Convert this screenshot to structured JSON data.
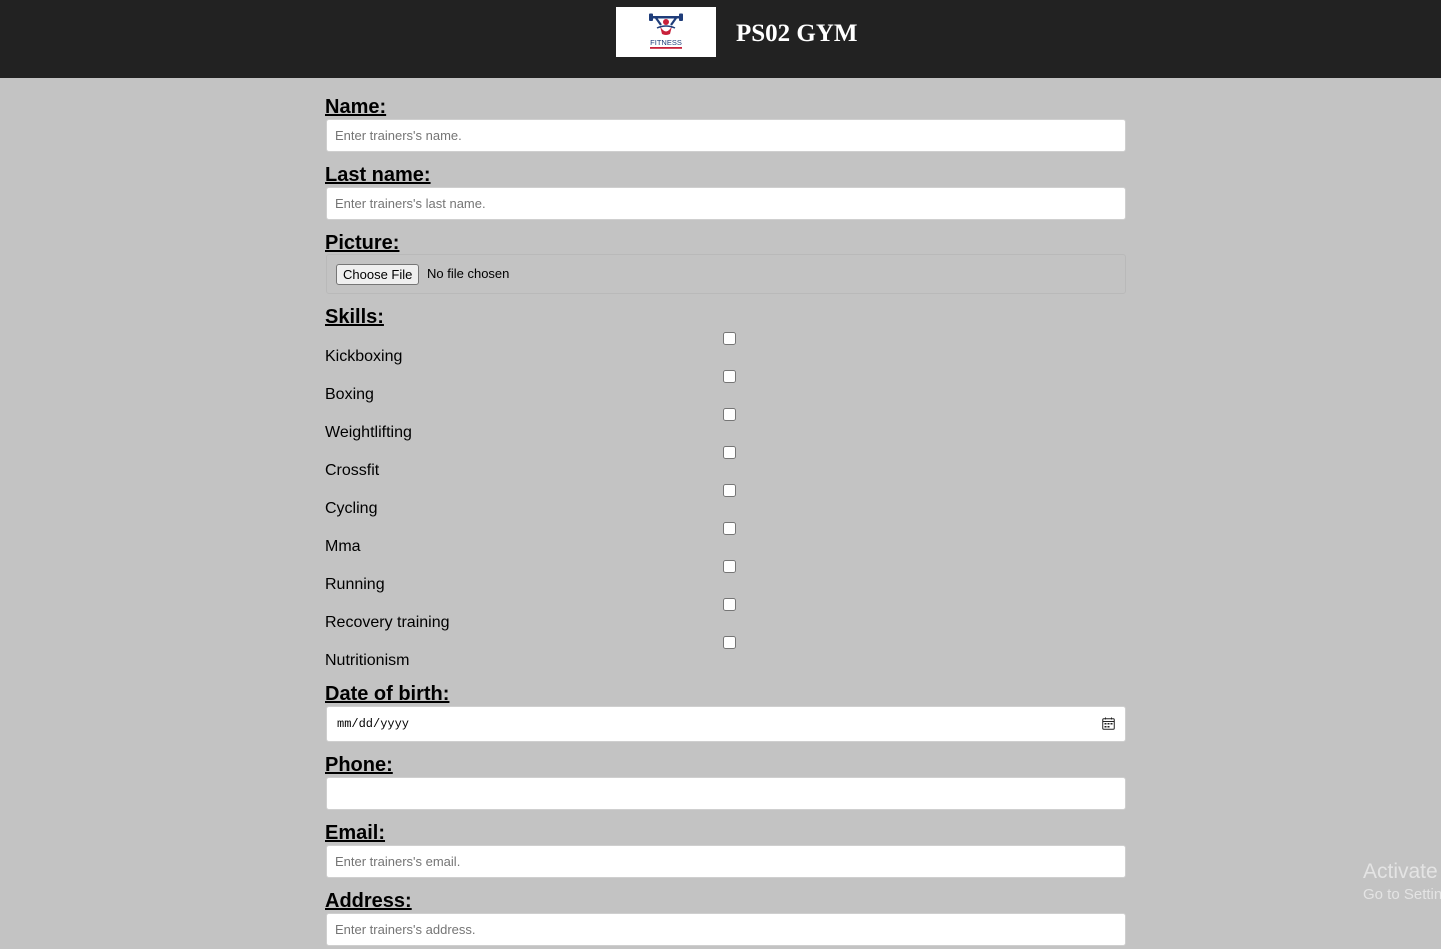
{
  "header": {
    "logo_text": "FITNESS",
    "brand": "PS02 GYM"
  },
  "form": {
    "name": {
      "label": "Name:",
      "placeholder": "Enter trainers's name.",
      "value": ""
    },
    "last_name": {
      "label": "Last name:",
      "placeholder": "Enter trainers's last name.",
      "value": ""
    },
    "picture": {
      "label": "Picture:",
      "button": "Choose File",
      "status": "No file chosen"
    },
    "skills": {
      "label": "Skills:",
      "items": [
        {
          "label": "Kickboxing",
          "checked": false
        },
        {
          "label": "Boxing",
          "checked": false
        },
        {
          "label": "Weightlifting",
          "checked": false
        },
        {
          "label": "Crossfit",
          "checked": false
        },
        {
          "label": "Cycling",
          "checked": false
        },
        {
          "label": "Mma",
          "checked": false
        },
        {
          "label": "Running",
          "checked": false
        },
        {
          "label": "Recovery training",
          "checked": false
        },
        {
          "label": "Nutritionism",
          "checked": false
        }
      ]
    },
    "date_of_birth": {
      "label": "Date of birth:",
      "placeholder": "mm/dd/yyyy",
      "icon": "calendar-icon"
    },
    "phone": {
      "label": "Phone:",
      "value": ""
    },
    "email": {
      "label": "Email:",
      "placeholder": "Enter trainers's email.",
      "value": ""
    },
    "address": {
      "label": "Address:",
      "placeholder": "Enter trainers's address.",
      "value": ""
    }
  },
  "watermark": {
    "line1": "Activate Windows",
    "line2": "Go to Settings to activate Windows."
  },
  "colors": {
    "header_bg": "#222222",
    "page_bg": "#c3c3c3",
    "brand_text": "#ffffff",
    "logo_red": "#c8203a",
    "logo_navy": "#1f3d7a"
  }
}
